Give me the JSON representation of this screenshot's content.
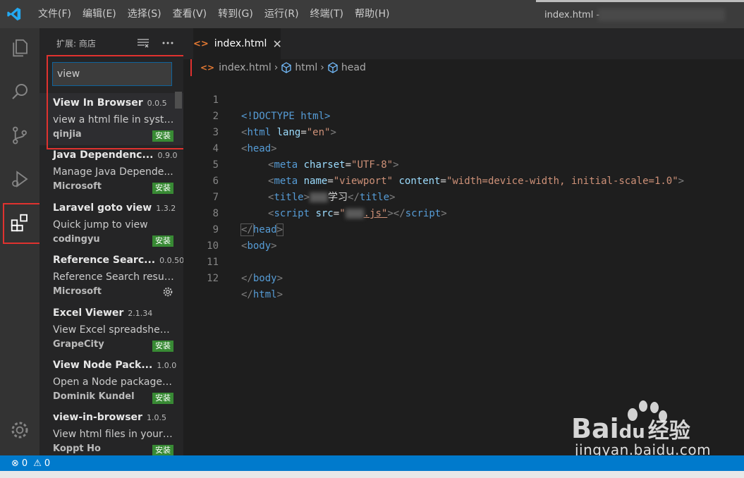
{
  "titlebar": {
    "menu": [
      "文件(F)",
      "编辑(E)",
      "选择(S)",
      "查看(V)",
      "转到(G)",
      "运行(R)",
      "终端(T)",
      "帮助(H)"
    ],
    "window_title": "index.html -"
  },
  "sidebar": {
    "title": "扩展: 商店",
    "search_value": "view",
    "extensions": [
      {
        "name": "View In Browser",
        "version": "0.0.5",
        "description": "view a html file in syste...",
        "publisher": "qinjia",
        "action": "安装"
      },
      {
        "name": "Java Dependenc...",
        "version": "0.9.0",
        "description": "Manage Java Depende...",
        "publisher": "Microsoft",
        "action": "安装"
      },
      {
        "name": "Laravel goto view",
        "version": "1.3.2",
        "description": "Quick jump to view",
        "publisher": "codingyu",
        "action": "安装"
      },
      {
        "name": "Reference Searc...",
        "version": "0.0.50",
        "description": "Reference Search resul...",
        "publisher": "Microsoft",
        "action": ""
      },
      {
        "name": "Excel Viewer",
        "version": "2.1.34",
        "description": "View Excel spreadsheet...",
        "publisher": "GrapeCity",
        "action": "安装"
      },
      {
        "name": "View Node Pack...",
        "version": "1.0.0",
        "description": "Open a Node package ...",
        "publisher": "Dominik Kundel",
        "action": "安装"
      },
      {
        "name": "view-in-browser",
        "version": "1.0.5",
        "description": "View html files in your ...",
        "publisher": "Koppt Ho",
        "action": "安装"
      }
    ]
  },
  "editor": {
    "tab_label": "index.html",
    "breadcrumb": [
      "index.html",
      "html",
      "head"
    ],
    "line_numbers": [
      "1",
      "2",
      "3",
      "4",
      "5",
      "6",
      "7",
      "8",
      "9",
      "10",
      "11",
      "12"
    ],
    "code": {
      "doctype": "<!DOCTYPE html>",
      "lt": "<",
      "gt": ">",
      "lt_slash": "</",
      "eq": "=",
      "html": "html",
      "head": "head",
      "body": "body",
      "meta": "meta",
      "title": "title",
      "script": "script",
      "lang": "lang",
      "lang_val": "\"en\"",
      "charset": "charset",
      "charset_val": "\"UTF-8\"",
      "name": "name",
      "name_val": "\"viewport\"",
      "content": "content",
      "content_val": "\"width=device-width, initial-scale=1.0\"",
      "title_text": "学习",
      "src": "src",
      "src_q1": "\"",
      "src_js": ".js\""
    }
  },
  "statusbar": {
    "errors": "0",
    "warnings": "0"
  },
  "watermark": {
    "brand": "Bai",
    "brand2": "du",
    "brand_cn": "经验",
    "url": "jingyan.baidu.com"
  },
  "colors": {
    "accent": "#007acc",
    "install": "#388a34",
    "highlight_box": "#e0322f"
  }
}
